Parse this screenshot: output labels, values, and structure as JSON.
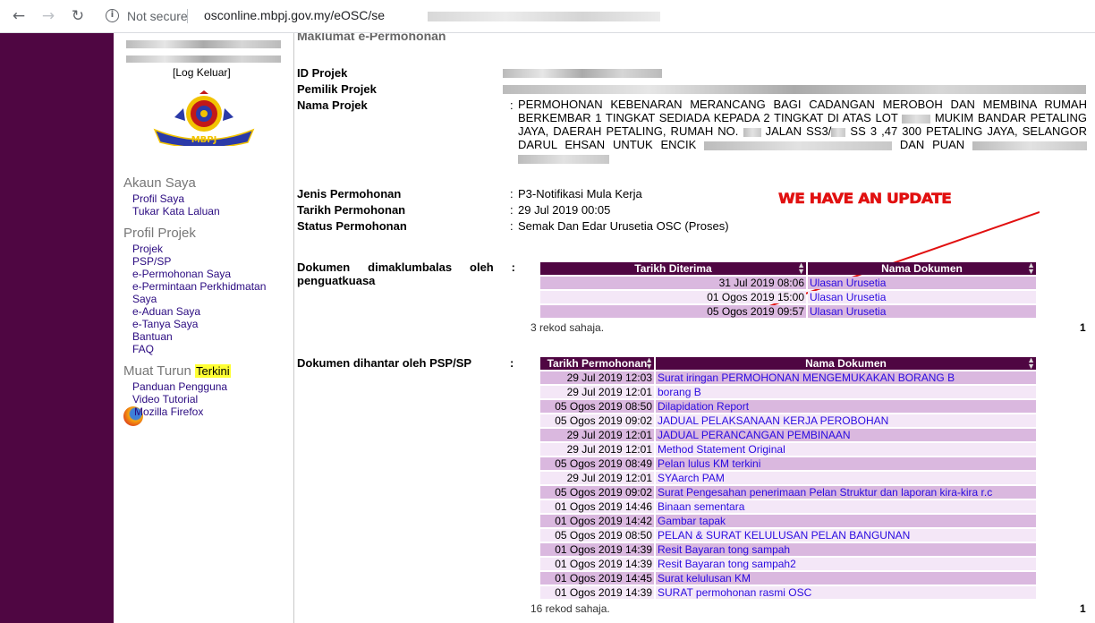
{
  "browser": {
    "security_label": "Not secure",
    "url": "osconline.mbpj.gov.my/eOSC/se"
  },
  "sidebar": {
    "logout": "Log Keluar",
    "logo_text": "MBPJ",
    "akaun_title": "Akaun Saya",
    "akaun_items": [
      "Profil Saya",
      "Tukar Kata Laluan"
    ],
    "profil_title": "Profil Projek",
    "profil_items": [
      "Projek",
      "PSP/SP",
      "e-Permohonan Saya",
      "e-Permintaan Perkhidmatan",
      "Saya",
      "e-Aduan Saya",
      "e-Tanya Saya",
      "Bantuan",
      "FAQ"
    ],
    "muat_title": "Muat Turun",
    "muat_badge": "Terkini",
    "muat_items": [
      "Panduan Pengguna",
      "Video Tutorial"
    ],
    "firefox_label": "Mozilla Firefox"
  },
  "main": {
    "header": "Maklumat e-Permohonan",
    "labels": {
      "id_projek": "ID Projek",
      "pemilik_projek": "Pemilik Projek",
      "nama_projek": "Nama Projek",
      "jenis": "Jenis Permohonan",
      "tarikh": "Tarikh Permohonan",
      "status": "Status Permohonan"
    },
    "colon": ":",
    "nama_projek": {
      "part1": "PERMOHONAN KEBENARAN MERANCANG BAGI CADANGAN MEROBOH DAN MEMBINA RUMAH BERKEMBAR 1 TINGKAT SEDIADA KEPADA 2 TINGKAT DI ATAS LOT",
      "part2": "MUKIM BANDAR PETALING JAYA, DAERAH PETALING, RUMAH NO.",
      "part3": "JALAN SS3/",
      "part4": "SS 3 ,47 300 PETALING JAYA, SELANGOR DARUL EHSAN UNTUK ENCIK",
      "part5": "DAN PUAN"
    },
    "jenis": "P3-Notifikasi Mula Kerja",
    "tarikh": "29 Jul 2019 00:05",
    "status": "Semak Dan Edar Urusetia OSC (Proses)",
    "annotation": "WE HAVE AN UPDATE",
    "annotation_color": "#e11010"
  },
  "dokumen_maklumbalas": {
    "label": "Dokumen dimaklumbalas oleh : penguatkuasa",
    "label_line1": "Dokumen dimaklumbalas oleh :",
    "label_line2": "penguatkuasa",
    "headers": [
      "Tarikh Diterima",
      "Nama Dokumen"
    ],
    "rows": [
      {
        "date": "31 Jul 2019 08:06",
        "doc": "Ulasan Urusetia"
      },
      {
        "date": "01 Ogos 2019 15:00",
        "doc": "Ulasan Urusetia"
      },
      {
        "date": "05 Ogos 2019 09:57",
        "doc": "Ulasan Urusetia"
      }
    ],
    "record_count": "3 rekod sahaja.",
    "page": "1"
  },
  "dokumen_psp": {
    "label": "Dokumen dihantar oleh PSP/SP",
    "headers": [
      "Tarikh Permohonan",
      "Nama Dokumen"
    ],
    "rows": [
      {
        "date": "29 Jul 2019 12:03",
        "doc": "Surat iringan PERMOHONAN MENGEMUKAKAN BORANG B"
      },
      {
        "date": "29 Jul 2019 12:01",
        "doc": "borang B"
      },
      {
        "date": "05 Ogos 2019 08:50",
        "doc": "Dilapidation Report"
      },
      {
        "date": "05 Ogos 2019 09:02",
        "doc": "JADUAL PELAKSANAAN KERJA PEROBOHAN"
      },
      {
        "date": "29 Jul 2019 12:01",
        "doc": "JADUAL PERANCANGAN PEMBINAAN"
      },
      {
        "date": "29 Jul 2019 12:01",
        "doc": "Method Statement Original"
      },
      {
        "date": "05 Ogos 2019 08:49",
        "doc": "Pelan lulus KM terkini"
      },
      {
        "date": "29 Jul 2019 12:01",
        "doc": "SYAarch PAM"
      },
      {
        "date": "05 Ogos 2019 09:02",
        "doc": "Surat Pengesahan penerimaan Pelan Struktur dan laporan kira-kira r.c"
      },
      {
        "date": "01 Ogos 2019 14:46",
        "doc": "Binaan sementara"
      },
      {
        "date": "01 Ogos 2019 14:42",
        "doc": "Gambar tapak"
      },
      {
        "date": "05 Ogos 2019 08:50",
        "doc": "PELAN & SURAT KELULUSAN PELAN BANGUNAN"
      },
      {
        "date": "01 Ogos 2019 14:39",
        "doc": "Resit Bayaran tong sampah"
      },
      {
        "date": "01 Ogos 2019 14:39",
        "doc": "Resit Bayaran tong sampah2"
      },
      {
        "date": "01 Ogos 2019 14:45",
        "doc": "Surat kelulusan KM"
      },
      {
        "date": "01 Ogos 2019 14:39",
        "doc": "SURAT permohonan rasmi OSC"
      }
    ],
    "record_count": "16 rekod sahaja.",
    "page": "1"
  },
  "colors": {
    "brand_purple": "#4f0642",
    "row_odd": "#dab8df",
    "row_even": "#f4e7f7",
    "link": "#2a0ae0"
  },
  "icons": [
    "back-arrow-icon",
    "forward-arrow-icon",
    "reload-icon",
    "info-icon",
    "firefox-icon",
    "sort-icon"
  ]
}
